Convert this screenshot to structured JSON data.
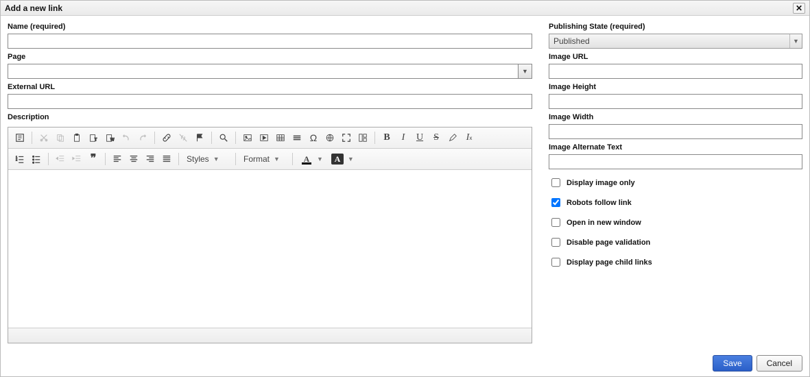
{
  "dialog": {
    "title": "Add a new link"
  },
  "left": {
    "name_label": "Name (required)",
    "name_value": "",
    "page_label": "Page",
    "page_value": "",
    "external_label": "External URL",
    "external_value": "",
    "desc_label": "Description"
  },
  "editor": {
    "styles_label": "Styles",
    "format_label": "Format"
  },
  "right": {
    "pub_label": "Publishing State (required)",
    "pub_value": "Published",
    "img_url_label": "Image URL",
    "img_url_value": "",
    "img_h_label": "Image Height",
    "img_h_value": "",
    "img_w_label": "Image Width",
    "img_w_value": "",
    "img_alt_label": "Image Alternate Text",
    "img_alt_value": "",
    "cb_display_image_only": {
      "label": "Display image only",
      "checked": false
    },
    "cb_robots_follow": {
      "label": "Robots follow link",
      "checked": true
    },
    "cb_open_new_window": {
      "label": "Open in new window",
      "checked": false
    },
    "cb_disable_validation": {
      "label": "Disable page validation",
      "checked": false
    },
    "cb_display_child": {
      "label": "Display page child links",
      "checked": false
    }
  },
  "footer": {
    "save": "Save",
    "cancel": "Cancel"
  }
}
